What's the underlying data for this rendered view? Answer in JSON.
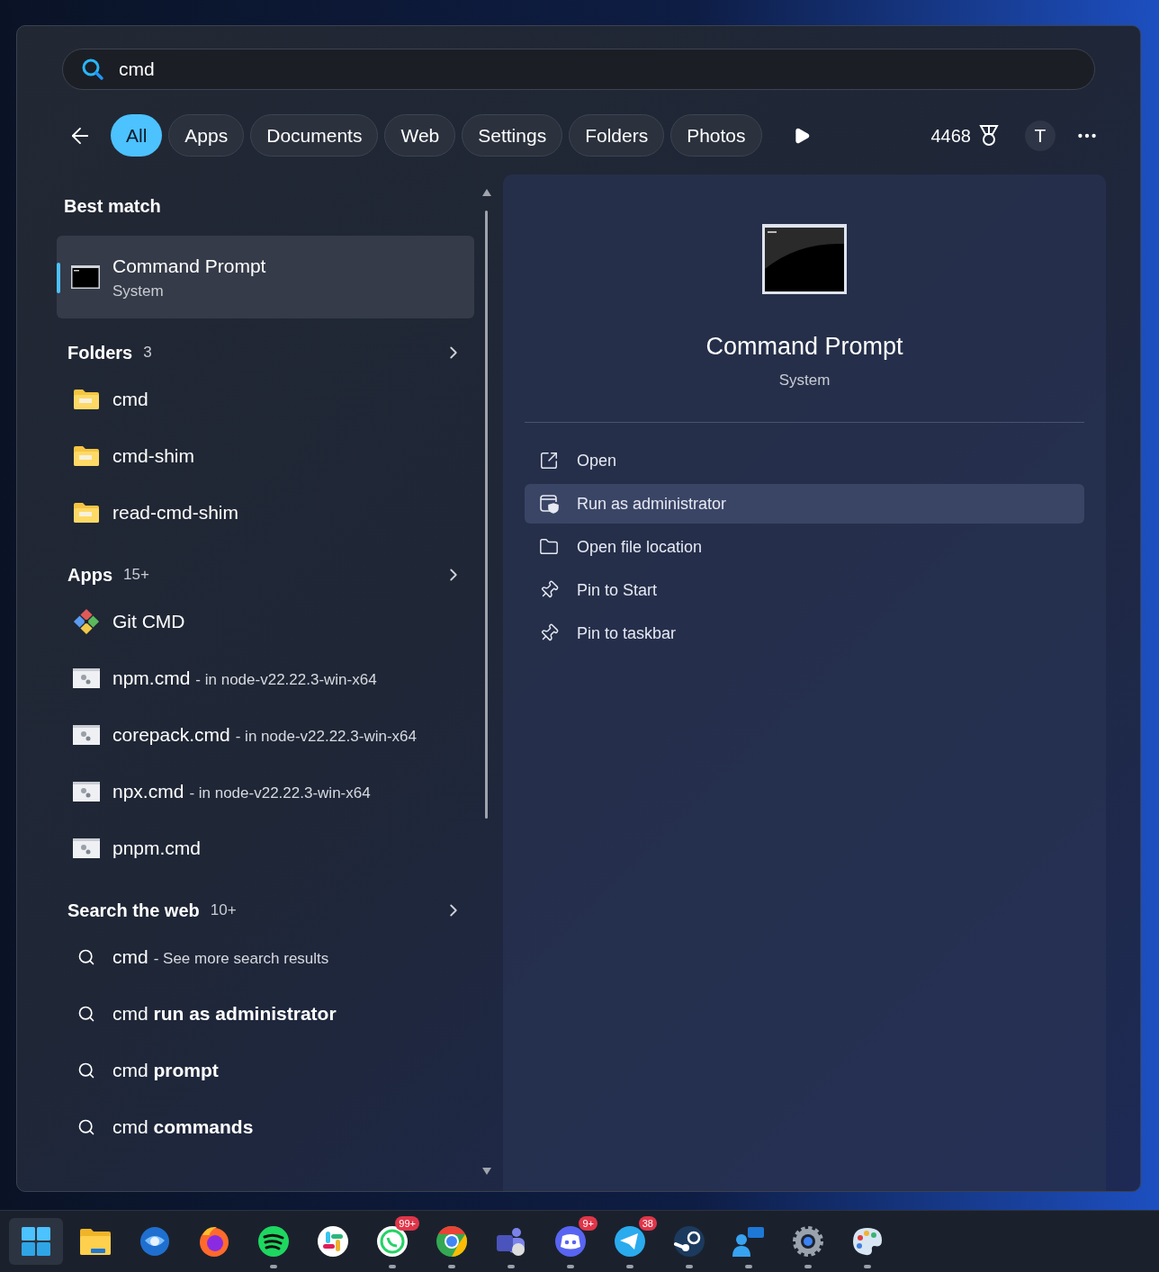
{
  "search": {
    "value": "cmd"
  },
  "filters": [
    {
      "label": "All",
      "selected": true
    },
    {
      "label": "Apps",
      "selected": false
    },
    {
      "label": "Documents",
      "selected": false
    },
    {
      "label": "Web",
      "selected": false
    },
    {
      "label": "Settings",
      "selected": false
    },
    {
      "label": "Folders",
      "selected": false
    },
    {
      "label": "Photos",
      "selected": false
    }
  ],
  "points": "4468",
  "account_initial": "T",
  "best_match": {
    "heading": "Best match",
    "title": "Command Prompt",
    "subtitle": "System",
    "selected": true
  },
  "sections": [
    {
      "heading": "Folders",
      "count": "3",
      "items": [
        {
          "kind": "folder",
          "name": "cmd"
        },
        {
          "kind": "folder",
          "name": "cmd-shim"
        },
        {
          "kind": "folder",
          "name": "read-cmd-shim"
        }
      ]
    },
    {
      "heading": "Apps",
      "count": "15+",
      "items": [
        {
          "kind": "git",
          "name": "Git CMD"
        },
        {
          "kind": "script",
          "name": "npm.cmd",
          "detail": "- in node-v22.22.3-win-x64"
        },
        {
          "kind": "script",
          "name": "corepack.cmd",
          "detail": "- in node-v22.22.3-win-x64"
        },
        {
          "kind": "script",
          "name": "npx.cmd",
          "detail": "- in node-v22.22.3-win-x64"
        },
        {
          "kind": "script",
          "name": "pnpm.cmd"
        }
      ]
    },
    {
      "heading": "Search the web",
      "count": "10+",
      "items": [
        {
          "kind": "web",
          "name": "cmd",
          "detail": "- See more search results"
        },
        {
          "kind": "web",
          "name": "cmd **run as administrator**"
        },
        {
          "kind": "web",
          "name": "cmd **prompt**"
        },
        {
          "kind": "web",
          "name": "cmd **commands**"
        }
      ]
    }
  ],
  "preview": {
    "title": "Command Prompt",
    "subtitle": "System",
    "actions": [
      {
        "kind": "open",
        "label": "Open",
        "selected": false
      },
      {
        "kind": "admin",
        "label": "Run as administrator",
        "selected": true
      },
      {
        "kind": "location",
        "label": "Open file location",
        "selected": false
      },
      {
        "kind": "pin",
        "label": "Pin to Start",
        "selected": false
      },
      {
        "kind": "pin",
        "label": "Pin to taskbar",
        "selected": false
      }
    ]
  },
  "taskbar": [
    {
      "kind": "start",
      "running": false
    },
    {
      "kind": "explorer",
      "running": false
    },
    {
      "kind": "thunderbird",
      "running": false
    },
    {
      "kind": "firefox",
      "running": false
    },
    {
      "kind": "spotify",
      "running": true
    },
    {
      "kind": "slack",
      "running": false
    },
    {
      "kind": "whatsapp",
      "running": true,
      "badge": "99+"
    },
    {
      "kind": "chrome",
      "running": true
    },
    {
      "kind": "teams",
      "running": true
    },
    {
      "kind": "discord",
      "running": true,
      "badge": "9+"
    },
    {
      "kind": "telegram",
      "running": true,
      "badge": "38"
    },
    {
      "kind": "steam",
      "running": true
    },
    {
      "kind": "people",
      "running": true
    },
    {
      "kind": "settings",
      "running": true
    },
    {
      "kind": "paint",
      "running": true
    }
  ]
}
